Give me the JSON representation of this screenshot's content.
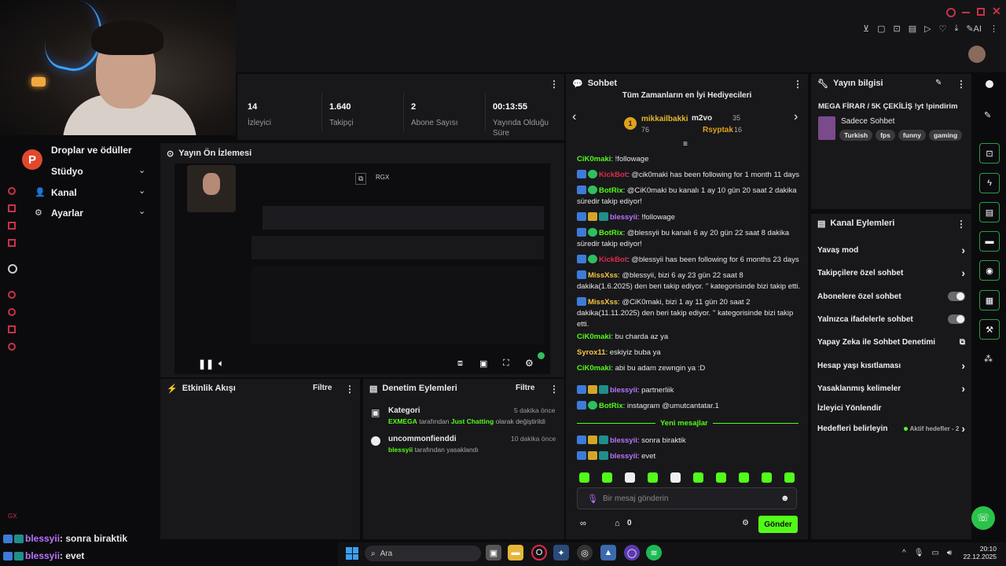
{
  "sidebar": {
    "items": [
      {
        "label": "Droplar ve ödüller"
      },
      {
        "label": "Stüdyo"
      },
      {
        "label": "Kanal"
      },
      {
        "label": "Ayarlar"
      }
    ],
    "bottom_tag": "GX"
  },
  "stats": {
    "items": [
      {
        "value": "14",
        "label": "İzleyici"
      },
      {
        "value": "1.640",
        "label": "Takipçi"
      },
      {
        "value": "2",
        "label": "Abone Sayısı"
      },
      {
        "value": "00:13:55",
        "label": "Yayında Olduğu Süre"
      }
    ]
  },
  "preview": {
    "title": "Yayın Ön İzlemesi",
    "rgx": "RGX"
  },
  "activity": {
    "title": "Etkinlik Akışı",
    "filter": "Filtre"
  },
  "moderation": {
    "title": "Denetim Eylemleri",
    "filter": "Filtre",
    "entries": [
      {
        "title": "Kategori",
        "time": "5 dakika önce",
        "user": "EXMEGA",
        "mid": "tarafından",
        "target": "Just Chatting",
        "rest": "olarak değiştirildi"
      },
      {
        "title": "uncommonfienddi",
        "time": "10 dakika önce",
        "user": "blessyii",
        "mid": "tarafından yasaklandı"
      }
    ]
  },
  "chat": {
    "title": "Sohbet",
    "gifters_title": "Tüm Zamanların en İyi Hediyecileri",
    "gifters": [
      {
        "rank": "1",
        "name": "mikkailbakki",
        "count": "76"
      },
      {
        "name": "m2vo",
        "count": "35"
      },
      {
        "name": "Rsyptak",
        "count": "16"
      }
    ],
    "messages": [
      {
        "user": "CiK0maki",
        "text": "!followage"
      },
      {
        "user": "KickBot",
        "text": "@cik0maki has been following for 1 month 11 days"
      },
      {
        "user": "BotRix",
        "text": "@CiK0maki bu kanalı 1 ay 10 gün 20 saat 2 dakika süredir takip ediyor!"
      },
      {
        "user": "blessyii",
        "text": "!followage"
      },
      {
        "user": "BotRix",
        "text": "@blessyii bu kanalı 6 ay 20 gün 22 saat 8 dakika süredir takip ediyor!"
      },
      {
        "user": "KickBot",
        "text": "@blessyii has been following for 6 months 23 days"
      },
      {
        "user": "MissXss",
        "text": "@blessyii, bizi 6 ay 23 gün 22 saat 8 dakika(1.6.2025) den beri takip ediyor. '' kategorisinde bizi takip etti."
      },
      {
        "user": "MissXss",
        "text": "@CiK0maki, bizi 1 ay 11 gün 20 saat 2 dakika(11.11.2025) den beri takip ediyor. '' kategorisinde bizi takip etti."
      },
      {
        "user": "CiK0maki",
        "text": "bu charda az ya"
      },
      {
        "user": "Syrox11",
        "text": "eskiyiz buba ya"
      },
      {
        "user": "CiK0maki",
        "text": "abi bu adam zewngin ya :D"
      },
      {
        "user": "blessyii",
        "text": "partnerliik"
      },
      {
        "user": "BotRix",
        "text": "instagram @umutcantatar.1"
      }
    ],
    "new_messages": "Yeni mesajlar",
    "new": [
      {
        "user": "blessyii",
        "text": "sonra biraktik"
      },
      {
        "user": "blessyii",
        "text": "evet"
      }
    ],
    "placeholder": "Bir mesaj gönderin",
    "send": "Gönder",
    "points": "0"
  },
  "stream_info": {
    "title": "Yayın bilgisi",
    "stream_title": "MEGA FİRAR / 5K ÇEKİLİŞ !yt !pindirim",
    "category": "Sadece Sohbet",
    "tags": [
      "Turkish",
      "fps",
      "funny",
      "gaming"
    ]
  },
  "channel_actions": {
    "title": "Kanal Eylemleri",
    "items": [
      {
        "label": "Yavaş mod"
      },
      {
        "label": "Takipçilere özel sohbet"
      },
      {
        "label": "Abonelere özel sohbet"
      },
      {
        "label": "Yalnızca ifadelerle sohbet"
      },
      {
        "label": "Yapay Zeka ile Sohbet Denetimi"
      },
      {
        "label": "Hesap yaşı kısıtlaması"
      },
      {
        "label": "Yasaklanmış kelimeler"
      },
      {
        "label": "İzleyici Yönlendir"
      },
      {
        "label": "Hedefleri belirleyin"
      }
    ],
    "goals_status": "Aktif hedefler - 2"
  },
  "overlay_chat": [
    {
      "user": "blessyii",
      "text": ": sonra biraktik"
    },
    {
      "user": "blessyii",
      "text": ": evet"
    }
  ],
  "taskbar": {
    "search": "Ara",
    "time": "20:10",
    "date": "22.12.2025"
  },
  "browser": {
    "ai": "AI"
  },
  "colors": {
    "kick_green": "#53fc18",
    "panel": "#18181b",
    "bg": "#0b0b0d"
  }
}
